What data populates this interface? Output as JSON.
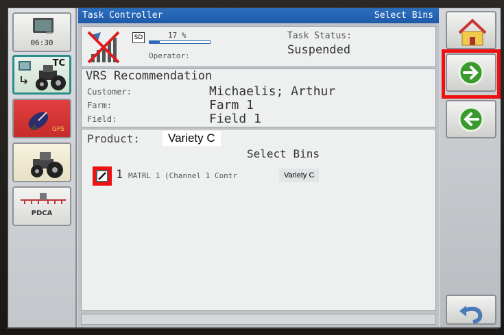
{
  "clock": "06:30",
  "sidebar": {
    "tc_label": "TC",
    "gps_label": "GPS",
    "pdca_label": "PDCA"
  },
  "titlebar": {
    "title": "Task Controller",
    "screen_name": "Select Bins"
  },
  "status": {
    "card_label": "SD",
    "percent": "17 %",
    "progress": 0.17,
    "operator_label": "Operator:",
    "task_status_label": "Task Status:",
    "task_status_value": "Suspended"
  },
  "task": {
    "name": "VRS Recommendation",
    "customer_label": "Customer:",
    "customer_value": "Michaelis; Arthur",
    "farm_label": "Farm:",
    "farm_value": "Farm 1",
    "field_label": "Field:",
    "field_value": "Field 1"
  },
  "product": {
    "label": "Product:",
    "value": "Variety C",
    "section_title": "Select Bins",
    "bins": [
      {
        "number": "1",
        "description": "MATRL 1 (Channel 1 Contr",
        "variety": "Variety C"
      }
    ]
  },
  "colors": {
    "titlebar": "#1f5aa8",
    "highlight": "#ee1111",
    "arrow_green": "#3a9a2e"
  },
  "icons": {
    "home": "home-icon",
    "next": "arrow-right-icon",
    "back": "arrow-left-icon",
    "undo": "undo-icon"
  }
}
